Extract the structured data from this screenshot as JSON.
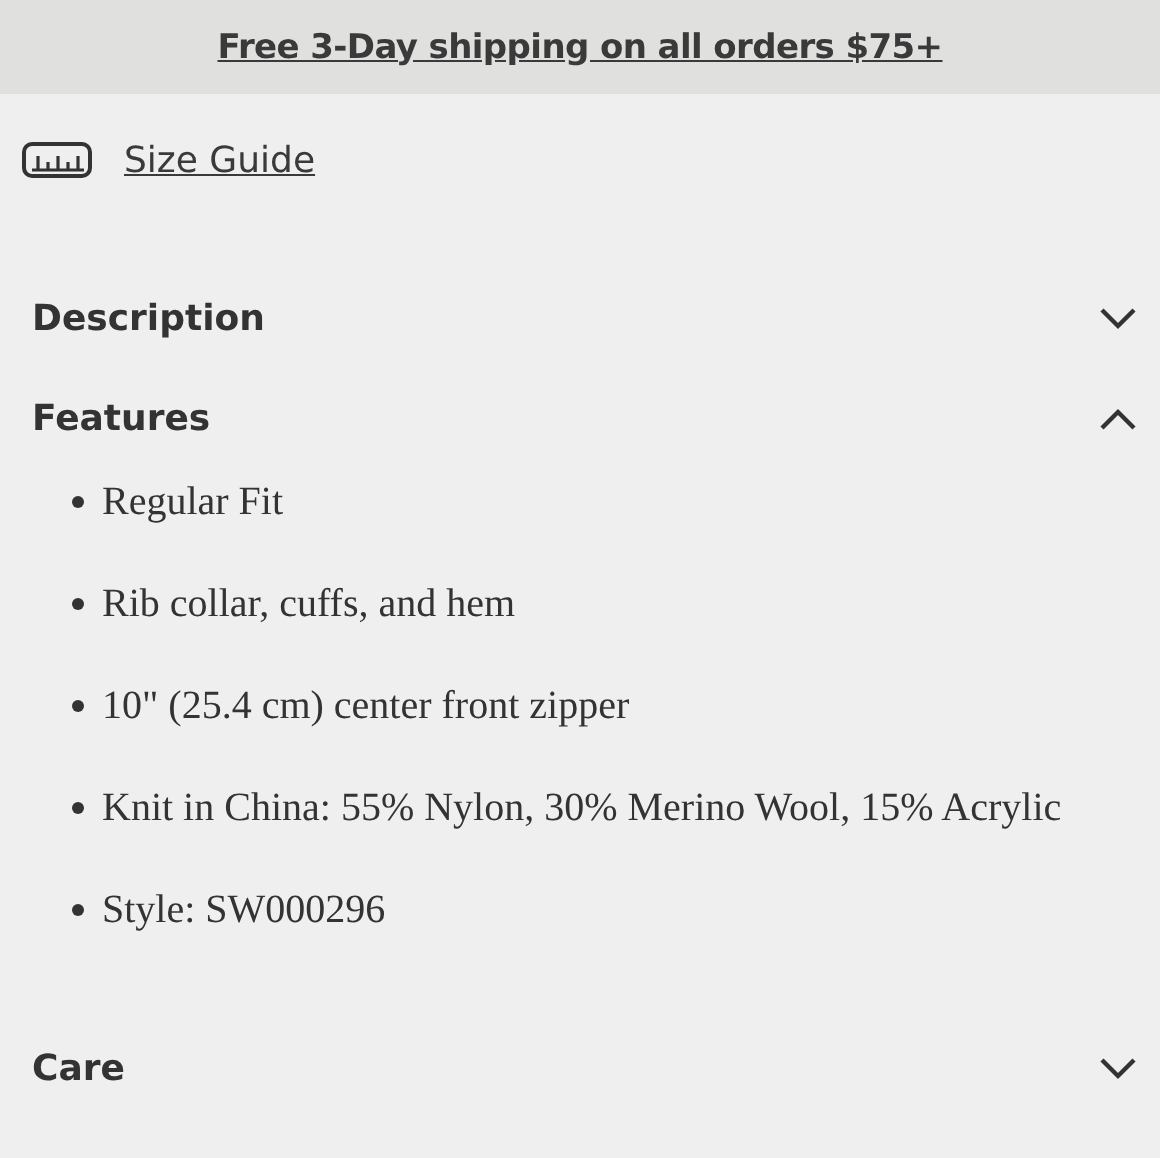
{
  "banner": {
    "text": "Free 3-Day shipping on all orders $75+"
  },
  "size_guide": {
    "label": "Size Guide"
  },
  "sections": [
    {
      "title": "Description",
      "expanded": false
    },
    {
      "title": "Features",
      "expanded": true,
      "items": [
        "Regular Fit",
        "Rib collar, cuffs, and hem",
        "10\" (25.4 cm) center front zipper",
        "Knit in China: 55% Nylon, 30% Merino Wool, 15% Acrylic",
        "Style: SW000296"
      ]
    },
    {
      "title": "Care",
      "expanded": false
    }
  ]
}
